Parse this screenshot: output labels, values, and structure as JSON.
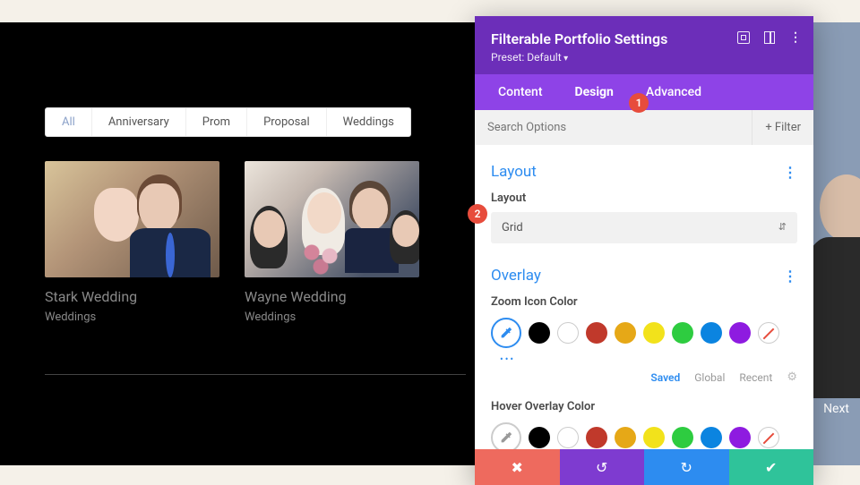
{
  "filters": {
    "items": [
      "All",
      "Anniversary",
      "Prom",
      "Proposal",
      "Weddings"
    ],
    "active_index": 0
  },
  "cards": [
    {
      "title": "Stark Wedding",
      "category": "Weddings"
    },
    {
      "title": "Wayne Wedding",
      "category": "Weddings"
    }
  ],
  "nav": {
    "next": "Next"
  },
  "panel": {
    "title": "Filterable Portfolio Settings",
    "preset_label": "Preset: Default",
    "tabs": {
      "content": "Content",
      "design": "Design",
      "advanced": "Advanced",
      "active": "design"
    },
    "search_placeholder": "Search Options",
    "filter_button": "+ Filter",
    "sections": {
      "layout": {
        "title": "Layout",
        "field_label": "Layout",
        "value": "Grid"
      },
      "overlay": {
        "title": "Overlay",
        "zoom_label": "Zoom Icon Color",
        "hover_label": "Hover Overlay Color",
        "swatch_tabs": {
          "saved": "Saved",
          "global": "Global",
          "recent": "Recent",
          "active": "saved"
        }
      }
    }
  },
  "badges": {
    "b1": "1",
    "b2": "2"
  },
  "colors": {
    "swatches": [
      "picker",
      "black",
      "white",
      "red",
      "orange",
      "yellow",
      "green",
      "blue",
      "purple",
      "none"
    ]
  }
}
